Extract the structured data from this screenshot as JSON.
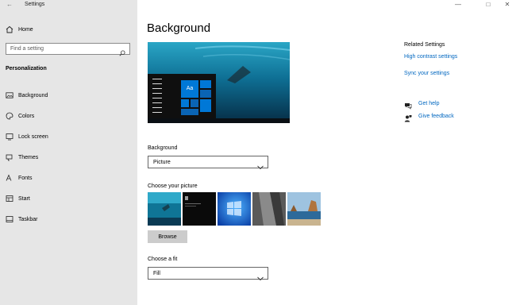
{
  "window": {
    "title": "Settings"
  },
  "sidebar": {
    "home_label": "Home",
    "search_placeholder": "Find a setting",
    "section_title": "Personalization",
    "items": [
      {
        "label": "Background",
        "icon": "image-icon"
      },
      {
        "label": "Colors",
        "icon": "palette-icon"
      },
      {
        "label": "Lock screen",
        "icon": "lock-screen-icon"
      },
      {
        "label": "Themes",
        "icon": "themes-icon"
      },
      {
        "label": "Fonts",
        "icon": "fonts-icon"
      },
      {
        "label": "Start",
        "icon": "start-icon"
      },
      {
        "label": "Taskbar",
        "icon": "taskbar-icon"
      }
    ]
  },
  "main": {
    "title": "Background",
    "preview": {
      "tile_text": "Aa"
    },
    "background_label": "Background",
    "background_value": "Picture",
    "choose_picture_label": "Choose your picture",
    "browse_label": "Browse",
    "fit_label": "Choose a fit",
    "fit_value": "Fill"
  },
  "related": {
    "title": "Related Settings",
    "links": [
      "High contrast settings",
      "Sync your settings"
    ],
    "help_label": "Get help",
    "feedback_label": "Give feedback"
  },
  "colors": {
    "accent": "#0067c0",
    "sidebar_bg": "#e6e6e6",
    "tile_blue": "#0078d7"
  }
}
